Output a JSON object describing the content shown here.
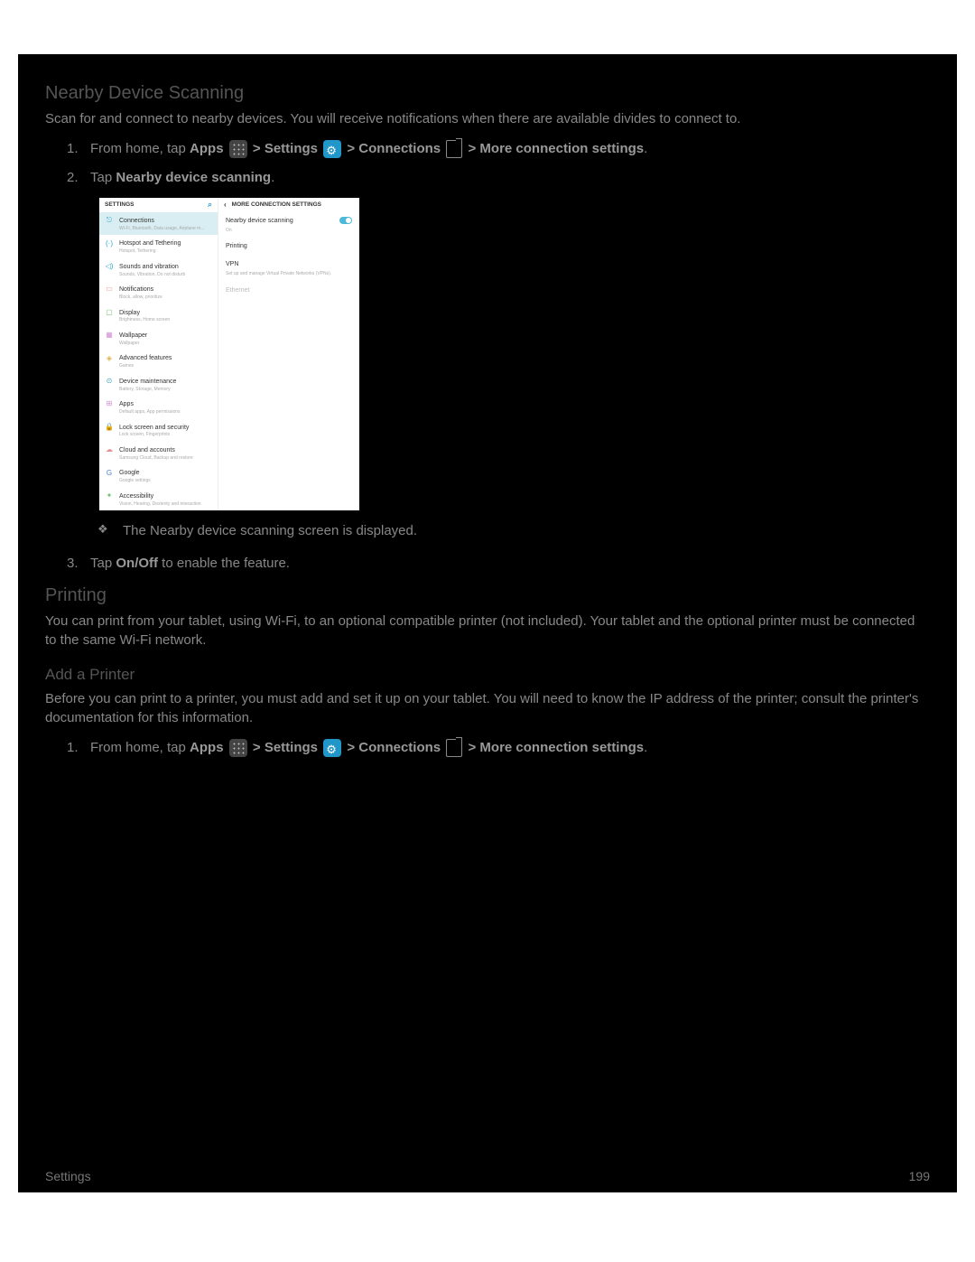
{
  "section1": {
    "heading": "Nearby Device Scanning",
    "intro": "Scan for and connect to nearby devices. You will receive notifications when there are available divides to connect to.",
    "steps": {
      "s1_pre": "From home, tap ",
      "apps": "Apps",
      "settings": "Settings",
      "connections": "Connections",
      "more_conn": "More connection settings",
      "gt": " >",
      "period": ".",
      "s2_pre": "Tap ",
      "s2_bold": "Nearby device scanning",
      "sub": "The Nearby device scanning screen is displayed.",
      "s3_pre": "Tap ",
      "s3_bold": "On/Off",
      "s3_post": " to enable the feature."
    }
  },
  "section2": {
    "heading": "Printing",
    "intro": "You can print from your tablet, using Wi-Fi, to an optional compatible printer (not included). Your tablet and the optional printer must be connected to the same Wi-Fi network.",
    "sub_heading": "Add a Printer",
    "sub_intro": "Before you can print to a printer, you must add and set it up on your tablet. You will need to know the IP address of the printer; consult the printer's documentation for this information."
  },
  "mock": {
    "left_header": "SETTINGS",
    "right_header": "MORE CONNECTION SETTINGS",
    "left_items": [
      {
        "icon": "⎋",
        "color": "#2aa5c8",
        "title": "Connections",
        "sub": "Wi-Fi, Bluetooth, Data usage, Airplane m..."
      },
      {
        "icon": "(·)",
        "color": "#2aa5c8",
        "title": "Hotspot and Tethering",
        "sub": "Hotspot, Tethering"
      },
      {
        "icon": "◁)",
        "color": "#2aa5c8",
        "title": "Sounds and vibration",
        "sub": "Sounds, Vibration, Do not disturb"
      },
      {
        "icon": "▭",
        "color": "#e89090",
        "title": "Notifications",
        "sub": "Block, allow, prioritize"
      },
      {
        "icon": "▢",
        "color": "#6fbf73",
        "title": "Display",
        "sub": "Brightness, Home screen"
      },
      {
        "icon": "▦",
        "color": "#d48fd4",
        "title": "Wallpaper",
        "sub": "Wallpaper"
      },
      {
        "icon": "◈",
        "color": "#e0b050",
        "title": "Advanced features",
        "sub": "Games"
      },
      {
        "icon": "⊙",
        "color": "#3aa0c0",
        "title": "Device maintenance",
        "sub": "Battery, Storage, Memory"
      },
      {
        "icon": "⊞",
        "color": "#d090d0",
        "title": "Apps",
        "sub": "Default apps, App permissions"
      },
      {
        "icon": "🔒",
        "color": "#5aa5d0",
        "title": "Lock screen and security",
        "sub": "Lock screen, Fingerprints"
      },
      {
        "icon": "☁",
        "color": "#e89090",
        "title": "Cloud and accounts",
        "sub": "Samsung Cloud, Backup and restore"
      },
      {
        "icon": "G",
        "color": "#5080d0",
        "title": "Google",
        "sub": "Google settings"
      },
      {
        "icon": "✦",
        "color": "#6fbf73",
        "title": "Accessibility",
        "sub": "Vision, Hearing, Dexterity and interaction"
      }
    ],
    "right_items": [
      {
        "title": "Nearby device scanning",
        "sub": "On",
        "toggle": true
      },
      {
        "title": "Printing",
        "sub": ""
      },
      {
        "title": "VPN",
        "sub": "Set up and manage Virtual Private Networks (VPNs)."
      },
      {
        "title": "Ethernet",
        "sub": "",
        "dim": true
      }
    ]
  },
  "footer": {
    "left": "Settings",
    "right": "199"
  },
  "nums": {
    "n1": "1.",
    "n2": "2.",
    "n3": "3."
  }
}
